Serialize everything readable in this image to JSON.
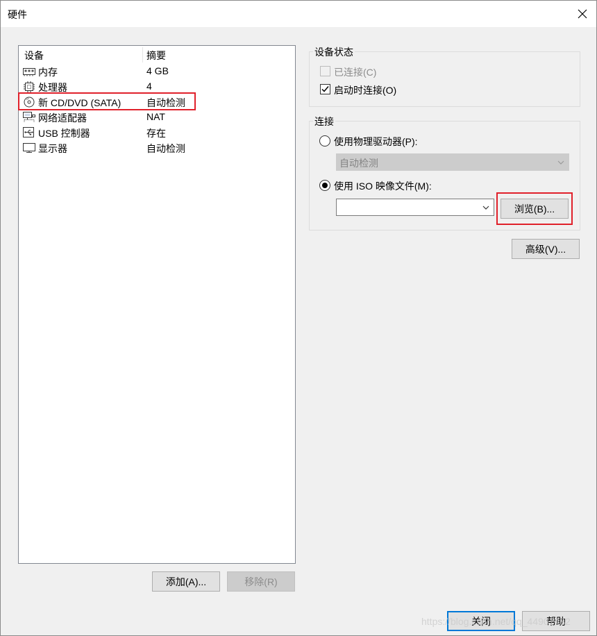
{
  "window": {
    "title": "硬件",
    "close_icon": "close-icon"
  },
  "device_list": {
    "header": {
      "device": "设备",
      "summary": "摘要"
    },
    "items": [
      {
        "name": "内存",
        "summary": "4 GB",
        "icon": "memory-icon"
      },
      {
        "name": "处理器",
        "summary": "4",
        "icon": "processor-icon"
      },
      {
        "name": "新 CD/DVD (SATA)",
        "summary": "自动检测",
        "icon": "cd-dvd-icon",
        "highlighted": true
      },
      {
        "name": "网络适配器",
        "summary": "NAT",
        "icon": "network-adapter-icon"
      },
      {
        "name": "USB 控制器",
        "summary": "存在",
        "icon": "usb-controller-icon"
      },
      {
        "name": "显示器",
        "summary": "自动检测",
        "icon": "display-icon"
      }
    ],
    "add_button": "添加(A)...",
    "remove_button": "移除(R)"
  },
  "device_status": {
    "label": "设备状态",
    "connected": {
      "label": "已连接(C)",
      "checked": false,
      "disabled": true
    },
    "connect_on_start": {
      "label": "启动时连接(O)",
      "checked": true
    }
  },
  "connection": {
    "label": "连接",
    "physical": {
      "label": "使用物理驱动器(P):",
      "selected": false
    },
    "physical_value": "自动检测",
    "iso": {
      "label": "使用 ISO 映像文件(M):",
      "selected": true
    },
    "iso_value": "",
    "browse_button": "浏览(B)..."
  },
  "advanced_button": "高级(V)...",
  "footer": {
    "close_button": "关闭",
    "help_button": "帮助",
    "watermark": "https://blog.csdn.net/qq_44907482"
  },
  "colors": {
    "highlight_box": "#e0202a",
    "default_button_border": "#0078d7"
  }
}
